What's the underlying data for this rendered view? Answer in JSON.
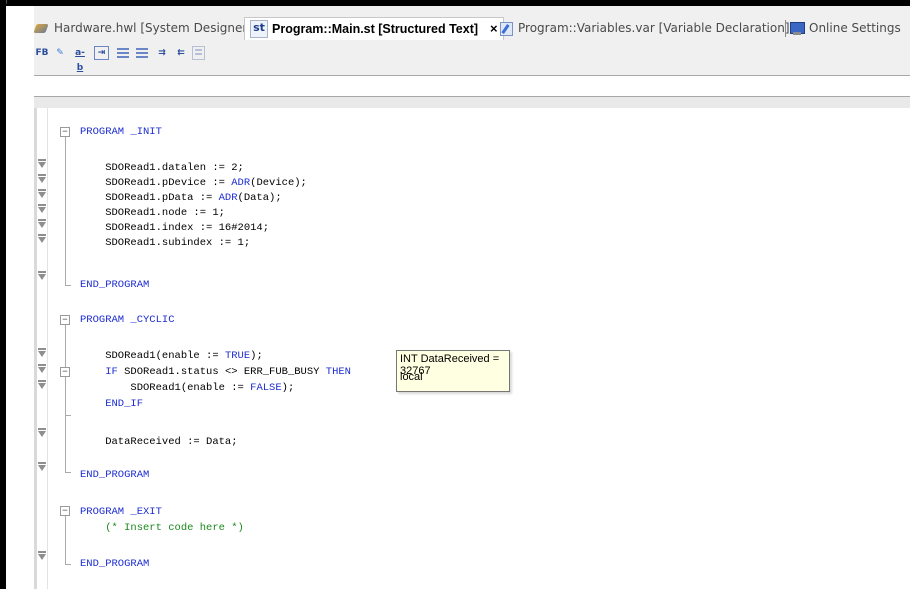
{
  "tabs": [
    {
      "label": "Hardware.hwl [System Designer]",
      "icon": "hardware-icon",
      "active": false
    },
    {
      "label": "Program::Main.st [Structured Text]",
      "icon": "st-icon",
      "icon_text": "st",
      "active": true,
      "close": "×"
    },
    {
      "label": "Program::Variables.var [Variable Declaration]",
      "icon": "variables-icon",
      "active": false
    },
    {
      "label": "Online Settings",
      "icon": "online-settings-icon",
      "active": false
    }
  ],
  "toolbar": {
    "fb_label": "FB",
    "ab_label": "a-b"
  },
  "code_lines": [
    {
      "text": "PROGRAM _INIT"
    },
    {
      "text": "    SDORead1.datalen := 2;"
    },
    {
      "text": "    SDORead1.pDevice := ADR(Device);"
    },
    {
      "text": "    SDORead1.pData := ADR(Data);"
    },
    {
      "text": "    SDORead1.node := 1;"
    },
    {
      "text": "    SDORead1.index := 16#2014;"
    },
    {
      "text": "    SDORead1.subindex := 1;"
    },
    {
      "text": "END_PROGRAM"
    },
    {
      "text": "PROGRAM _CYCLIC"
    },
    {
      "text": "    SDORead1(enable := TRUE);"
    },
    {
      "text": "    IF SDORead1.status <> ERR_FUB_BUSY THEN"
    },
    {
      "text": "        SDORead1(enable := FALSE);"
    },
    {
      "text": "    END_IF"
    },
    {
      "text": "    DataReceived := Data;"
    },
    {
      "text": "END_PROGRAM"
    },
    {
      "text": "PROGRAM _EXIT"
    },
    {
      "text": "    (* Insert code here *)"
    },
    {
      "text": "END_PROGRAM"
    }
  ],
  "tooltip": {
    "line1": "INT DataReceived = 32767",
    "line2": "local"
  },
  "colors": {
    "keyword": "#1c2cd1",
    "comment": "#1b8a1b",
    "tooltip_bg": "#ffffe1"
  }
}
